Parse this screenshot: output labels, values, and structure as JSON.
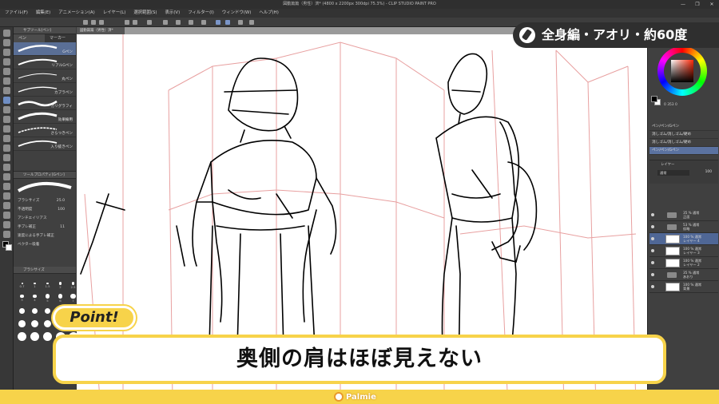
{
  "titlebar": {
    "title": "図動篇篇（男性）済* (4800 x 2200px 300dpi 75.3%) - CLIP STUDIO PAINT PRO"
  },
  "window_controls": [
    "—",
    "❐",
    "✕"
  ],
  "menu": [
    "ファイル(F)",
    "編集(E)",
    "アニメーション(A)",
    "レイヤー(L)",
    "選択範囲(S)",
    "表示(V)",
    "フィルター(I)",
    "ウィンドウ(W)",
    "ヘルプ(H)"
  ],
  "sub_tool": {
    "title": "サブツール[ペン]",
    "tabs": [
      "ペン",
      "マーカー"
    ],
    "brushes": [
      "Gペン",
      "リアルGペン",
      "丸ペン",
      "カブラペン",
      "カリグラフィ",
      "効果線用",
      "さらつきペン",
      "入り抜きペン"
    ],
    "selected_index": 0
  },
  "tool_property": {
    "title": "ツールプロパティ[Gペン]",
    "rows": [
      {
        "label": "ブラシサイズ",
        "value": "25.0"
      },
      {
        "label": "不透明度",
        "value": "100"
      },
      {
        "label": "アンチエイリアス",
        "value": ""
      },
      {
        "label": "手ブレ補正",
        "value": "11"
      },
      {
        "label": "速度による手ブレ補正",
        "value": ""
      },
      {
        "label": "ベクター吸着",
        "value": ""
      }
    ]
  },
  "brush_size": {
    "title": "ブラシサイズ",
    "sizes": [
      "0.7",
      "1",
      "1.5",
      "2",
      "2.5",
      "3",
      "4",
      "5",
      "6",
      "7",
      "8",
      "10",
      "12",
      "15",
      "17",
      "20",
      "25",
      "30",
      "40",
      "50",
      "60",
      "70",
      "80",
      "100",
      "120"
    ]
  },
  "document_tab": {
    "label": "図動篇篇（男性）済*"
  },
  "color": {
    "primary": "#000000",
    "secondary": "#ffffff",
    "hsv_readout": "0 353 0"
  },
  "sets": {
    "items": [
      "ペン/ペン/Gペン",
      "消しゴム/消しゴム/硬め",
      "消しゴム/消しゴム/硬め",
      "ペン/ペン/Gペン"
    ],
    "selected_index": 3
  },
  "layer_panel": {
    "title": "レイヤー",
    "blend_mode": "通常",
    "opacity": "100",
    "layers": [
      {
        "name": "35 % 通常\n正面",
        "kind": "folder"
      },
      {
        "name": "53 % 通常\n仮略",
        "kind": "folder"
      },
      {
        "name": "100 % 通常\nレイヤー 4",
        "kind": "layer",
        "selected": true
      },
      {
        "name": "100 % 通常\nレイヤー 3",
        "kind": "layer"
      },
      {
        "name": "100 % 通常\nレイヤー 2",
        "kind": "layer"
      },
      {
        "name": "35 % 通常\nあおり",
        "kind": "folder"
      },
      {
        "name": "100 % 通常\n背景",
        "kind": "layer"
      }
    ]
  },
  "overlay": {
    "badge_text": "全身編・アオリ・約60度",
    "point_label": "Point!",
    "caption": "奥側の肩はほぼ見えない",
    "logo_text": "Palmie"
  },
  "colors": {
    "accent_yellow": "#f7d34a",
    "selection_blue": "#5b72a0",
    "guide_red": "#e8a0a0"
  }
}
